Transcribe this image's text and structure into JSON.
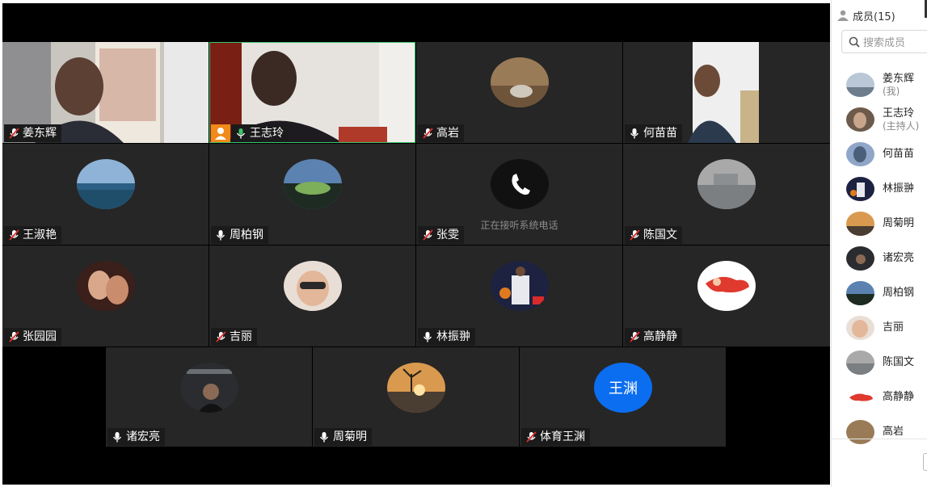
{
  "sidebar": {
    "title": "成员(15)",
    "search_placeholder": "搜索成员",
    "members": [
      {
        "name": "姜东辉",
        "tag": "(我)"
      },
      {
        "name": "王志玲",
        "tag": "(主持人)"
      },
      {
        "name": "何苗苗"
      },
      {
        "name": "林振翀"
      },
      {
        "name": "周菊明"
      },
      {
        "name": "诸宏亮"
      },
      {
        "name": "周柏钢"
      },
      {
        "name": "吉丽"
      },
      {
        "name": "陈国文"
      },
      {
        "name": "高静静"
      },
      {
        "name": "高岩"
      }
    ]
  },
  "tiles": [
    {
      "name": "姜东辉",
      "mic": "muted",
      "video": true
    },
    {
      "name": "王志玲",
      "mic": "active",
      "video": true,
      "host": true,
      "speaking": true
    },
    {
      "name": "高岩",
      "mic": "muted"
    },
    {
      "name": "何苗苗",
      "mic": "on",
      "video": true
    },
    {
      "name": "王淑艳",
      "mic": "muted"
    },
    {
      "name": "周柏钢",
      "mic": "on"
    },
    {
      "name": "张雯",
      "mic": "muted",
      "status": "正在接听系统电话"
    },
    {
      "name": "陈国文",
      "mic": "muted"
    },
    {
      "name": "张园园",
      "mic": "muted"
    },
    {
      "name": "吉丽",
      "mic": "muted"
    },
    {
      "name": "林振翀",
      "mic": "on"
    },
    {
      "name": "高静静",
      "mic": "muted"
    },
    {
      "name": "诸宏亮",
      "mic": "on"
    },
    {
      "name": "周菊明",
      "mic": "on"
    },
    {
      "name": "体育王渊",
      "mic": "muted",
      "avatar_text": "王渊"
    }
  ],
  "colors": {
    "accent": "#0b6ef0",
    "speaking_green": "#3ac56b",
    "host_orange": "#f08a1a",
    "tile_bg": "#262626"
  }
}
